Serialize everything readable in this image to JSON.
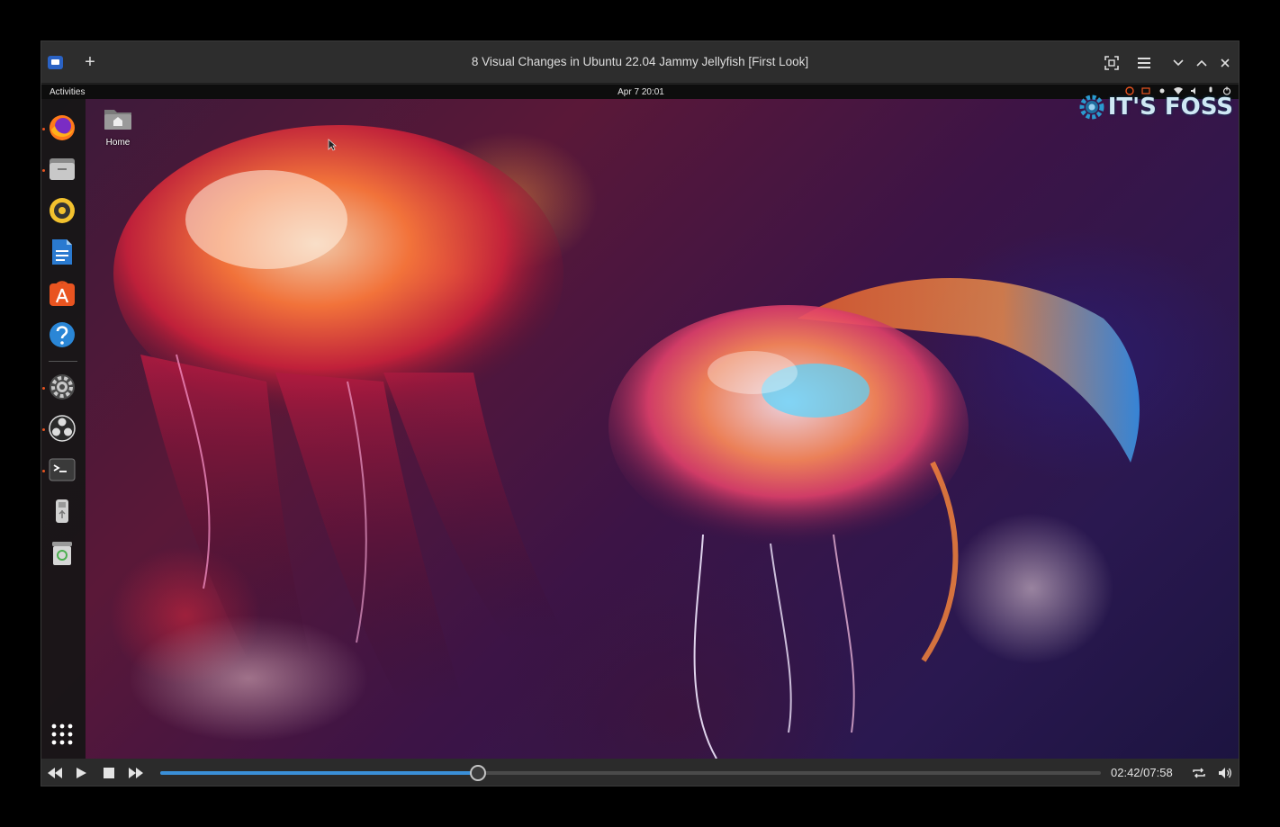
{
  "window": {
    "title": "8 Visual Changes in Ubuntu 22.04 Jammy Jellyfish [First Look]",
    "new_tab_label": "+"
  },
  "desktop": {
    "activities_label": "Activities",
    "clock": "Apr 7  20:01",
    "home_label": "Home",
    "watermark": "IT'S FOSS",
    "dock_items": [
      {
        "icon": "firefox-icon",
        "running": true
      },
      {
        "icon": "files-icon",
        "running": true
      },
      {
        "icon": "rhythmbox-icon",
        "running": false
      },
      {
        "icon": "libreoffice-writer-icon",
        "running": false
      },
      {
        "icon": "software-center-icon",
        "running": false
      },
      {
        "icon": "help-icon",
        "running": false
      },
      {
        "icon": "settings-icon",
        "running": true
      },
      {
        "icon": "obs-icon",
        "running": true
      },
      {
        "icon": "terminal-icon",
        "running": true
      },
      {
        "icon": "usb-drive-icon",
        "running": false
      },
      {
        "icon": "trash-icon",
        "running": false
      }
    ]
  },
  "player": {
    "current_time": "02:42",
    "total_time": "07:58",
    "time_display": "02:42/07:58",
    "progress": 0.338
  },
  "colors": {
    "accent": "#3a8fd8",
    "ubuntu_orange": "#e95420",
    "titlebar": "#2d2d2d"
  }
}
